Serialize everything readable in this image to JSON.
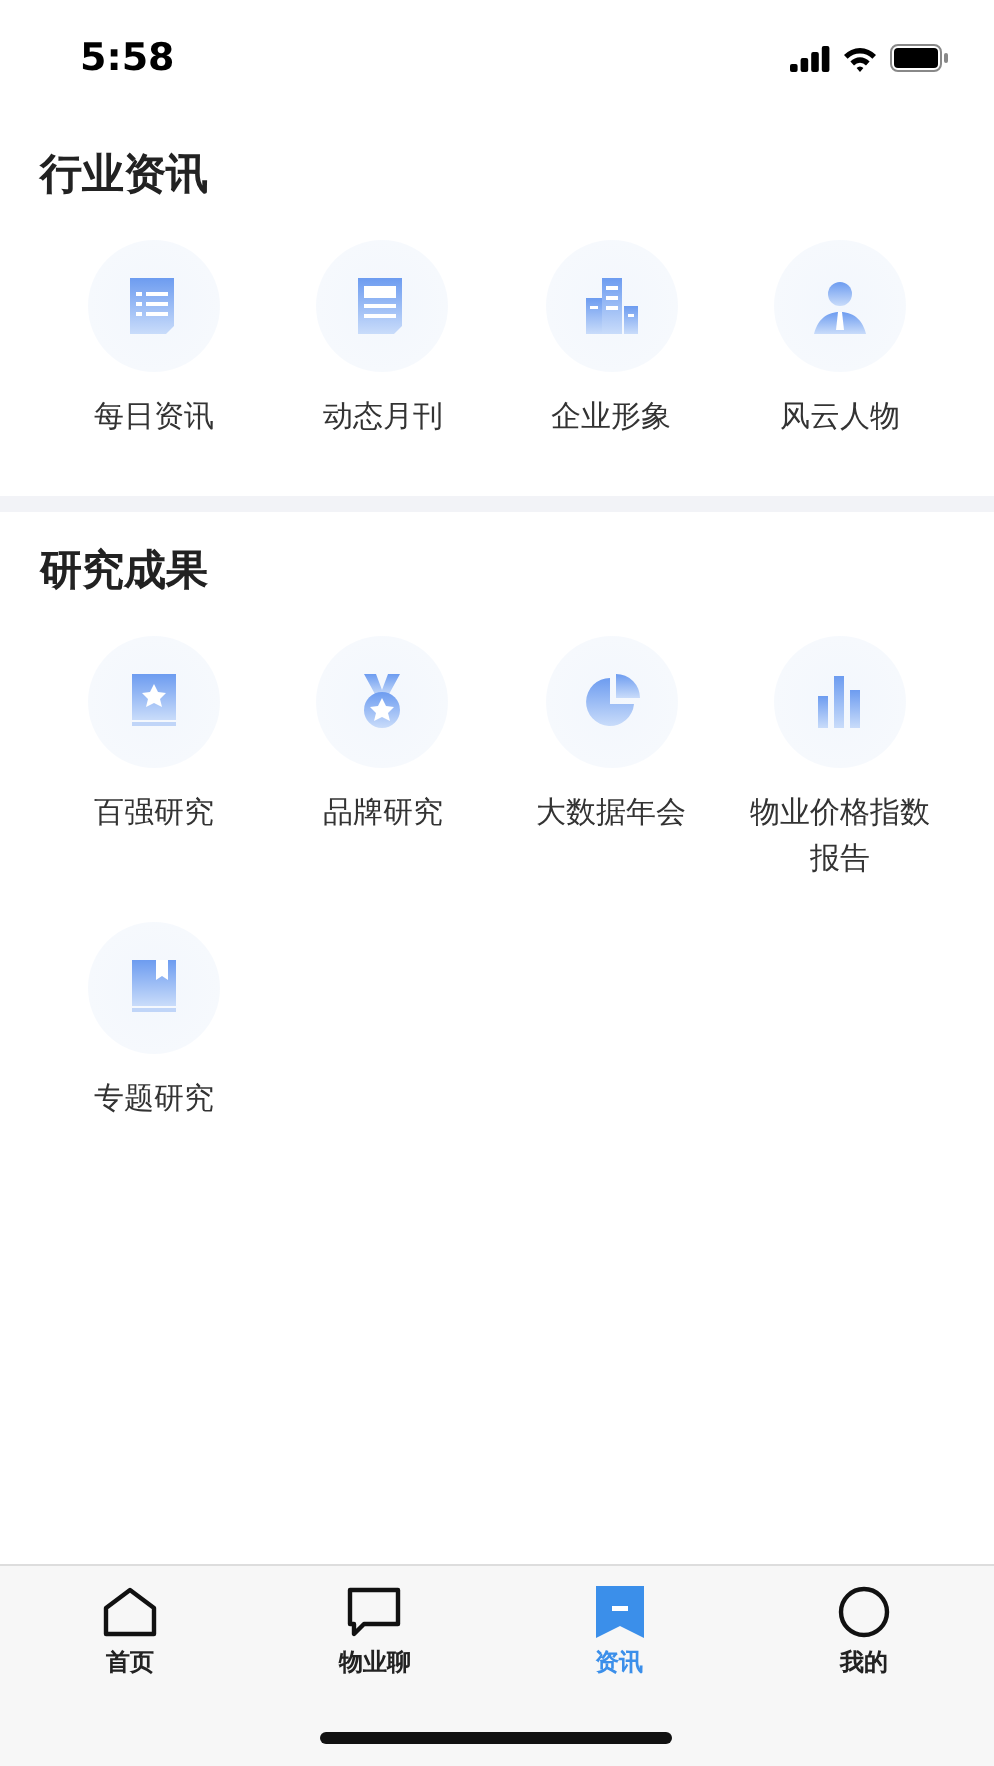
{
  "status_bar": {
    "time": "5:58"
  },
  "sections": [
    {
      "title": "行业资讯",
      "items": [
        {
          "label": "每日资讯",
          "kind": "list-doc"
        },
        {
          "label": "动态月刊",
          "kind": "form-doc"
        },
        {
          "label": "企业形象",
          "kind": "buildings"
        },
        {
          "label": "风云人物",
          "kind": "person"
        }
      ]
    },
    {
      "title": "研究成果",
      "items": [
        {
          "label": "百强研究",
          "kind": "book"
        },
        {
          "label": "品牌研究",
          "kind": "medal"
        },
        {
          "label": "大数据年会",
          "kind": "pie"
        },
        {
          "label": "物业价格指数报告",
          "kind": "bars"
        },
        {
          "label": "专题研究",
          "kind": "bookmark-book"
        }
      ]
    }
  ],
  "tab_bar": [
    {
      "label": "首页",
      "kind": "home",
      "selected": false
    },
    {
      "label": "物业聊",
      "kind": "chat",
      "selected": false
    },
    {
      "label": "资讯",
      "kind": "bookmark",
      "selected": true
    },
    {
      "label": "我的",
      "kind": "circle",
      "selected": false
    }
  ]
}
